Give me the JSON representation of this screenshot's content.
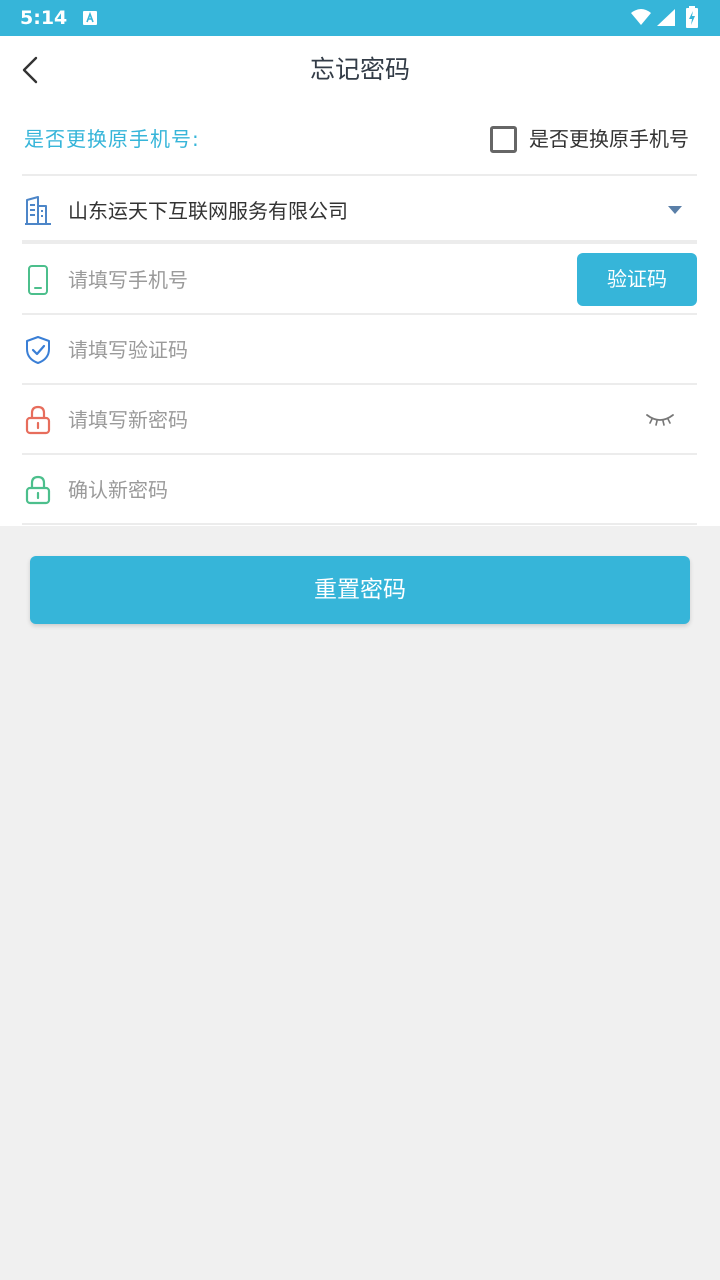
{
  "status_bar": {
    "time": "5:14",
    "icons": [
      "app-notification-icon",
      "wifi-icon",
      "signal-icon",
      "battery-charging-icon"
    ]
  },
  "header": {
    "back_icon": "chevron-left-icon",
    "title": "忘记密码"
  },
  "change_phone": {
    "label": "是否更换原手机号:",
    "checkbox_label": "是否更换原手机号",
    "checked": false
  },
  "company": {
    "icon": "building-icon",
    "value": "山东运天下互联网服务有限公司",
    "dropdown_icon": "caret-down-icon"
  },
  "phone": {
    "icon": "phone-icon",
    "placeholder": "请填写手机号",
    "sms_button": "验证码"
  },
  "code": {
    "icon": "shield-check-icon",
    "placeholder": "请填写验证码"
  },
  "new_password": {
    "icon": "lock-icon",
    "placeholder": "请填写新密码",
    "visibility_icon": "eye-closed-icon"
  },
  "confirm_password": {
    "icon": "lock-icon",
    "placeholder": "确认新密码"
  },
  "submit": {
    "label": "重置密码"
  },
  "colors": {
    "accent": "#36b5d9",
    "phone_icon": "#4cbf8c",
    "shield_icon": "#3a7fd6",
    "lock_red": "#e76d5c",
    "lock_green": "#4cbf8c",
    "building_icon": "#4d86c8"
  }
}
